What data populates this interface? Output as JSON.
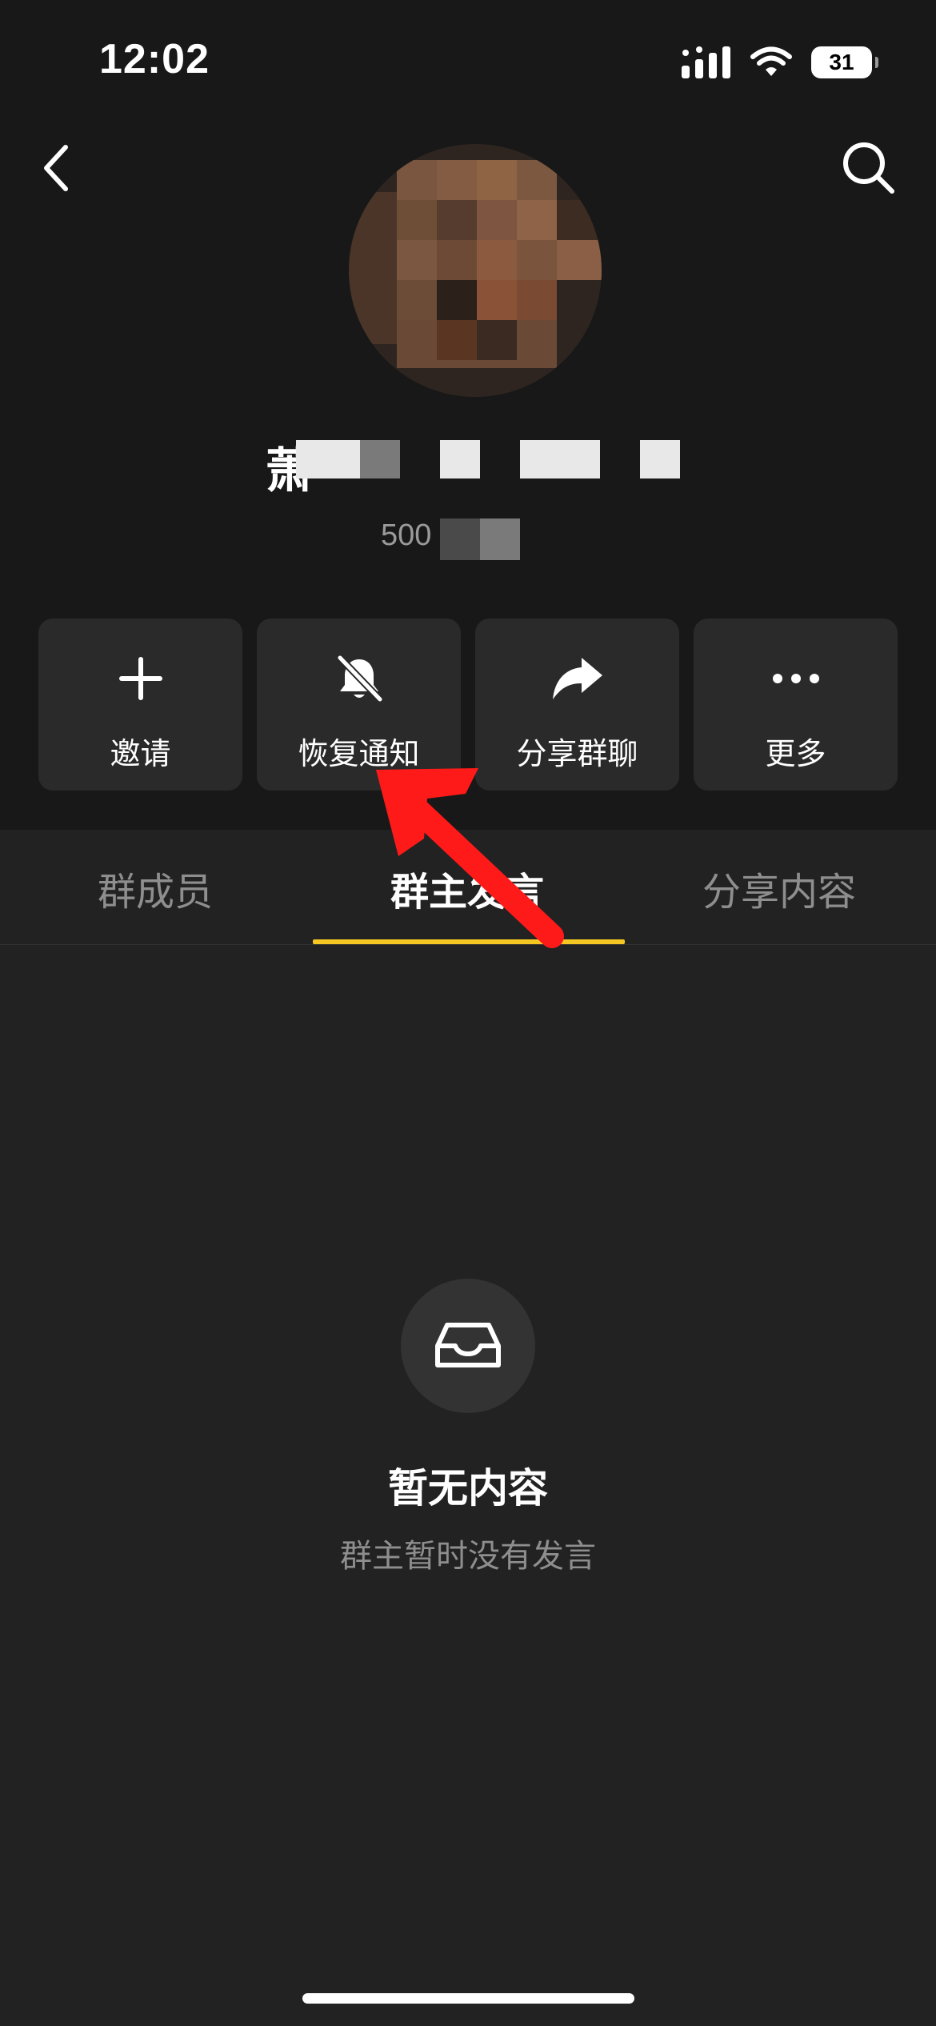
{
  "status_bar": {
    "time": "12:02",
    "battery": "31"
  },
  "nav": {
    "back_icon": "chevron-left-icon",
    "search_icon": "search-icon"
  },
  "group": {
    "name": "萧",
    "member_count": "500"
  },
  "actions": [
    {
      "label": "邀请",
      "icon": "plus-icon"
    },
    {
      "label": "恢复通知",
      "icon": "bell-off-icon"
    },
    {
      "label": "分享群聊",
      "icon": "share-arrow-icon"
    },
    {
      "label": "更多",
      "icon": "more-dots-icon"
    }
  ],
  "tabs": [
    {
      "label": "群成员",
      "active": false
    },
    {
      "label": "群主发言",
      "active": true
    },
    {
      "label": "分享内容",
      "active": false
    }
  ],
  "empty_state": {
    "icon": "inbox-tray-icon",
    "title": "暂无内容",
    "subtitle": "群主暂时没有发言"
  },
  "colors": {
    "accent": "#f5c723",
    "header_bg": "#181818",
    "body_bg": "#222222",
    "annotation_arrow": "#ff1a1a"
  }
}
